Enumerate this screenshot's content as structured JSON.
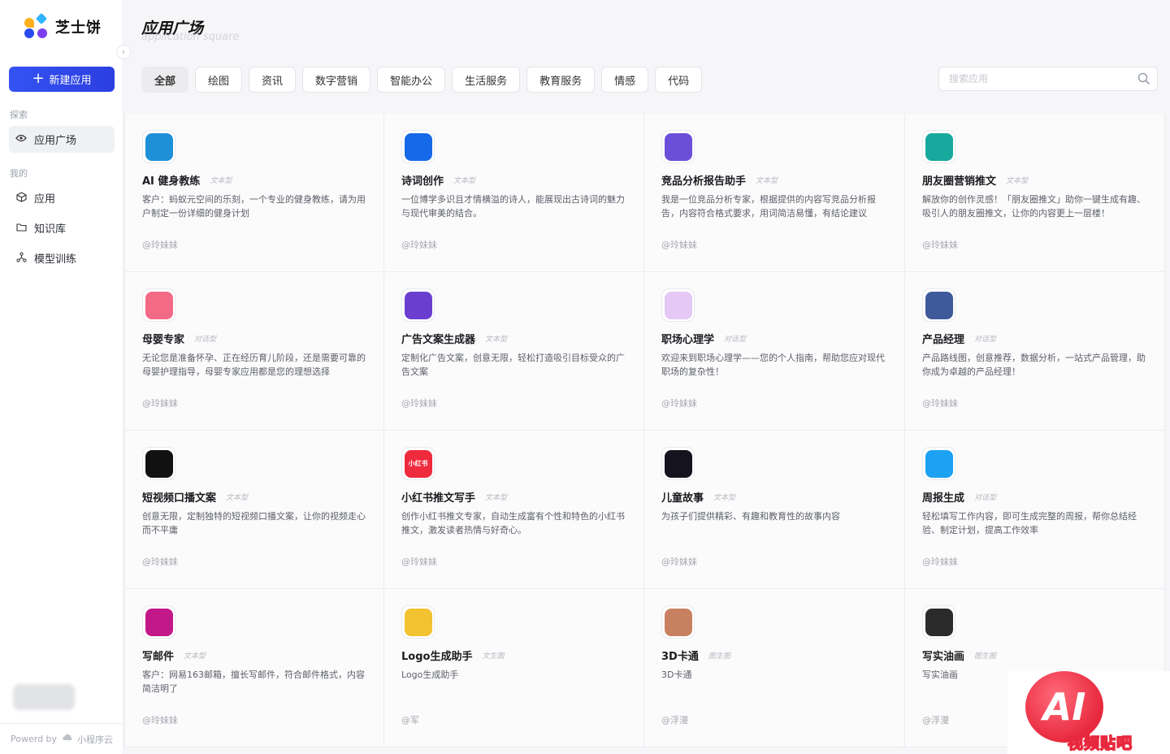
{
  "sidebar": {
    "logo_text": "芝士饼",
    "new_app": "新建应用",
    "section_explore": "探索",
    "section_mine": "我的",
    "items": [
      {
        "label": "应用广场",
        "icon": "plaza-icon"
      },
      {
        "label": "应用",
        "icon": "cube-icon"
      },
      {
        "label": "知识库",
        "icon": "folder-icon"
      },
      {
        "label": "模型训练",
        "icon": "network-icon"
      }
    ],
    "powered_label": "Powerd by",
    "powered_brand": "小程序云"
  },
  "header": {
    "title": "应用广场",
    "subtitle": "application square"
  },
  "tabs": [
    "全部",
    "绘图",
    "资讯",
    "数字营销",
    "智能办公",
    "生活服务",
    "教育服务",
    "情感",
    "代码"
  ],
  "search": {
    "placeholder": "搜索应用"
  },
  "cards": [
    {
      "name": "AI 健身教练",
      "type": "文本型",
      "desc": "客户：蚂蚁元空间的乐刻，一个专业的健身教练，请为用户制定一份详细的健身计划",
      "author": "@玲妹妹",
      "icon": "dumbbell-icon",
      "color": "#1e90d8"
    },
    {
      "name": "诗词创作",
      "type": "文本型",
      "desc": "一位博学多识且才情横溢的诗人，能展现出古诗词的魅力与现代审美的结合。",
      "author": "@玲妹妹",
      "icon": "window-icon",
      "color": "#1669e8"
    },
    {
      "name": "竞品分析报告助手",
      "type": "文本型",
      "desc": "我是一位竞品分析专家，根据提供的内容写竞品分析报告，内容符合格式要求，用词简洁易懂，有结论建议",
      "author": "@玲妹妹",
      "icon": "compass-icon",
      "color": "#6b4fd8"
    },
    {
      "name": "朋友圈营销推文",
      "type": "文本型",
      "desc": "解放你的创作灵感！「朋友圈推文」助你一键生成有趣、吸引人的朋友圈推文，让你的内容更上一层楼！",
      "author": "@玲妹妹",
      "icon": "ring-icon",
      "color": "#17a99e"
    },
    {
      "name": "母婴专家",
      "type": "对话型",
      "desc": "无论您是准备怀孕、正在经历育儿阶段，还是需要可靠的母婴护理指导，母婴专家应用都是您的理想选择",
      "author": "@玲妹妹",
      "icon": "baby-icon",
      "color": "#f26a86"
    },
    {
      "name": "广告文案生成器",
      "type": "文本型",
      "desc": "定制化广告文案，创意无限，轻松打造吸引目标受众的广告文案",
      "author": "@玲妹妹",
      "icon": "megaphone-icon",
      "color": "#6a3fd0"
    },
    {
      "name": "职场心理学",
      "type": "对话型",
      "desc": "欢迎来到职场心理学——您的个人指南，帮助您应对现代职场的复杂性！",
      "author": "@玲妹妹",
      "icon": "heart-icon",
      "color": "#e5c8f5"
    },
    {
      "name": "产品经理",
      "type": "对话型",
      "desc": "产品路线图，创意推荐，数据分析，一站式产品管理，助你成为卓越的产品经理！",
      "author": "@玲妹妹",
      "icon": "chart-icon",
      "color": "#3f5a9a"
    },
    {
      "name": "短视频口播文案",
      "type": "文本型",
      "desc": "创意无限，定制独特的短视频口播文案，让你的视频走心而不平庸",
      "author": "@玲妹妹",
      "icon": "play-icon",
      "color": "#111111"
    },
    {
      "name": "小红书推文写手",
      "type": "文本型",
      "desc": "创作小红书推文专家，自动生成富有个性和特色的小红书推文，激发读者热情与好奇心。",
      "author": "@玲妹妹",
      "icon": "xiaohongshu-icon",
      "color": "#ee2a3c",
      "icon_text": "小红书"
    },
    {
      "name": "儿童故事",
      "type": "文本型",
      "desc": "为孩子们提供精彩、有趣和教育性的故事内容",
      "author": "@玲妹妹",
      "icon": "crystal-icon",
      "color": "#15131d"
    },
    {
      "name": "周报生成",
      "type": "对话型",
      "desc": "轻松填写工作内容，即可生成完整的周报，帮你总结经验、制定计划，提高工作效率",
      "author": "@玲妹妹",
      "icon": "bubble-icon",
      "color": "#1da1f2"
    },
    {
      "name": "写邮件",
      "type": "文本型",
      "desc": "客户：网易163邮箱，擅长写邮件，符合邮件格式，内容简洁明了",
      "author": "@玲妹妹",
      "icon": "mail-icon",
      "color": "#c2188a"
    },
    {
      "name": "Logo生成助手",
      "type": "文生图",
      "desc": "Logo生成助手",
      "author": "@军",
      "icon": "brush-icon",
      "color": "#f2c230"
    },
    {
      "name": "3D卡通",
      "type": "图生图",
      "desc": "3D卡通",
      "author": "@浮漫",
      "icon": "cartoon-avatar-icon",
      "color": "#c88160"
    },
    {
      "name": "写实油画",
      "type": "图生图",
      "desc": "写实油画",
      "author": "@浮漫",
      "icon": "portrait-icon",
      "color": "#2b2b2b"
    }
  ],
  "watermark": {
    "big": "AI",
    "small": "视频贴吧"
  },
  "colors": {
    "primary": "#3552f3",
    "brand_red": "#e8283d"
  }
}
